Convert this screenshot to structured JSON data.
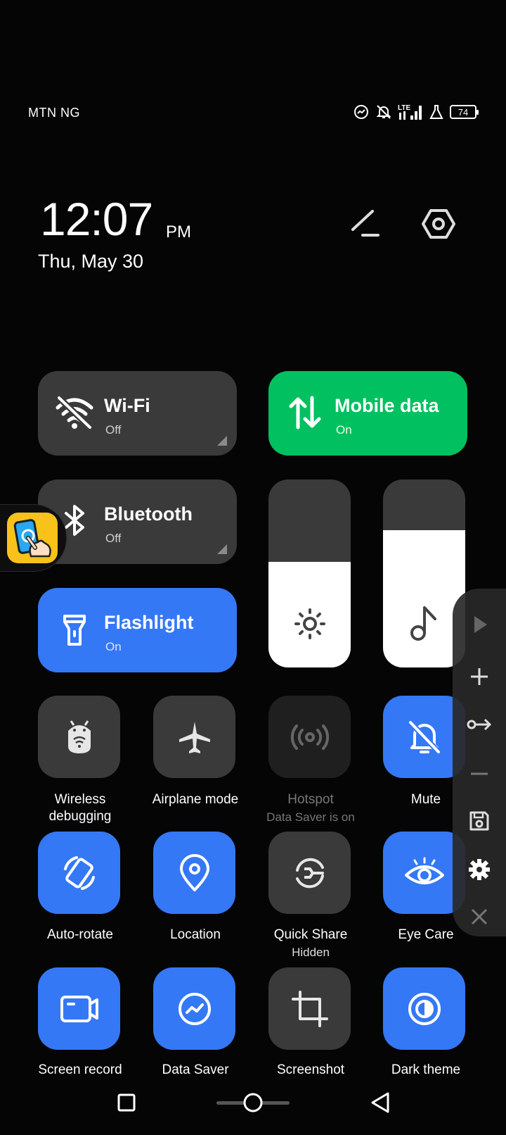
{
  "status_bar": {
    "carrier": "MTN NG",
    "network": "LTE",
    "battery": "74",
    "icons": [
      "data-saver-icon",
      "notifications-off-icon",
      "lte-signal-icon",
      "lab-flask-icon",
      "battery-icon"
    ]
  },
  "header": {
    "time": "12:07",
    "ampm": "PM",
    "date": "Thu, May 30",
    "edit_icon": "edit-icon",
    "settings_icon": "settings-icon"
  },
  "big_tiles": {
    "wifi": {
      "label": "Wi-Fi",
      "status": "Off"
    },
    "mobile_data": {
      "label": "Mobile data",
      "status": "On"
    },
    "bluetooth": {
      "label": "Bluetooth",
      "status": "Off"
    },
    "flashlight": {
      "label": "Flashlight",
      "status": "On"
    }
  },
  "sliders": {
    "brightness_level": 0.56,
    "volume_level": 0.73
  },
  "small_tiles": [
    {
      "label": "Wireless debugging",
      "sub": "",
      "state": "off"
    },
    {
      "label": "Airplane mode",
      "sub": "",
      "state": "off"
    },
    {
      "label": "Hotspot",
      "sub": "Data Saver is on",
      "state": "disabled"
    },
    {
      "label": "Mute",
      "sub": "",
      "state": "on"
    },
    {
      "label": "Auto-rotate",
      "sub": "",
      "state": "on"
    },
    {
      "label": "Location",
      "sub": "",
      "state": "on"
    },
    {
      "label": "Quick Share",
      "sub": "Hidden",
      "state": "off"
    },
    {
      "label": "Eye Care",
      "sub": "",
      "state": "on"
    },
    {
      "label": "Screen record",
      "sub": "",
      "state": "on"
    },
    {
      "label": "Data Saver",
      "sub": "",
      "state": "on"
    },
    {
      "label": "Screenshot",
      "sub": "",
      "state": "off"
    },
    {
      "label": "Dark theme",
      "sub": "",
      "state": "on"
    }
  ],
  "colors": {
    "accent_blue": "#3478f6",
    "mobile_green": "#00c060",
    "tile_gray": "#3a3a3a"
  },
  "floating_toolbar": [
    "play-icon",
    "add-icon",
    "swap-icon",
    "minus-icon",
    "save-icon",
    "gear-icon",
    "close-icon"
  ],
  "nav_bar": [
    "recents-button",
    "home-button",
    "back-button"
  ]
}
